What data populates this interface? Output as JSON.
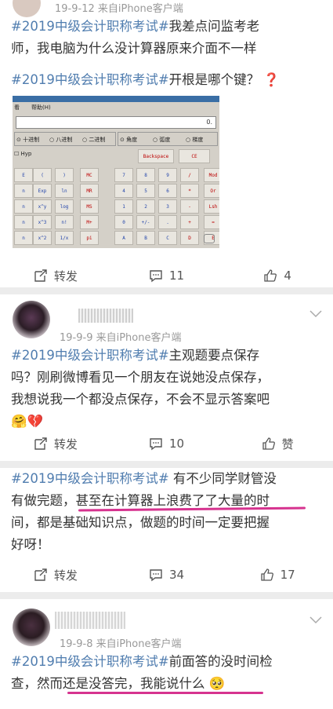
{
  "post1": {
    "meta": "19-9-12  来自iPhone客户端",
    "para1_topic": "#2019中级会计职称考试#",
    "para1_text_a": "我差点问监考老",
    "para1_text_b": "师，我电脑为什么没计算器原来介面不一样",
    "para2_topic": "#2019中级会计职称考试#",
    "para2_text": "开根是哪个键？",
    "para2_emoji": "❓",
    "repost_label": "转发",
    "comment_count": "11",
    "like_count": "4"
  },
  "calculator": {
    "menu_view": "看",
    "menu_help": "帮助(H)",
    "display_value": "0.",
    "radix": [
      "十进制",
      "八进制",
      "二进制"
    ],
    "angle": [
      "角度",
      "弧度",
      "梯度"
    ],
    "inv_label": "Hyp",
    "backspace": "Backspace",
    "ce": "CE",
    "keys_row1": [
      "E",
      "(",
      ")",
      "MC",
      "7",
      "8",
      "9",
      "/",
      "Mod"
    ],
    "keys_row2": [
      "n",
      "Exp",
      "ln",
      "MR",
      "4",
      "5",
      "6",
      "*",
      "Or"
    ],
    "keys_row3": [
      "n",
      "x^y",
      "log",
      "MS",
      "1",
      "2",
      "3",
      "-",
      "Lsh"
    ],
    "keys_row4": [
      "n",
      "x^3",
      "n!",
      "M+",
      "0",
      "+/-",
      ".",
      "+",
      "="
    ],
    "keys_row5": [
      "n",
      "x^2",
      "1/x",
      "pi",
      "A",
      "B",
      "C",
      "D",
      "E"
    ]
  },
  "post2": {
    "meta": "19-9-9  来自iPhone客户端",
    "topic": "#2019中级会计职称考试#",
    "text_a": "主观题要点保存",
    "text_b": "吗？刚刷微博看见一个朋友在说她没点保存，",
    "text_c": "我想说我一个都没点保存，不会不显示答案吧",
    "emoji": "🤗💔",
    "repost_label": "转发",
    "comment_count": "10",
    "like_label": "赞"
  },
  "post3": {
    "topic": "#2019中级会计职称考试#",
    "text_a": " 有不少同学财管没",
    "text_b": "有做完题，甚至在计算器上浪费了了大量的时",
    "text_c": "间，都是基础知识点，做题的时间一定要把握",
    "text_d": "好呀！",
    "repost_label": "转发",
    "comment_count": "34",
    "like_count": "17"
  },
  "post4": {
    "meta": "19-9-8  来自iPhone客户端",
    "topic": "#2019中级会计职称考试#",
    "text_a": "前面答的没时间检",
    "text_b": "查，然而还是没答完，我能说什么",
    "emoji": "🥺"
  },
  "colors": {
    "topic": "#507daf",
    "underline": "#d6338f",
    "text": "#333333",
    "meta": "#999999"
  }
}
